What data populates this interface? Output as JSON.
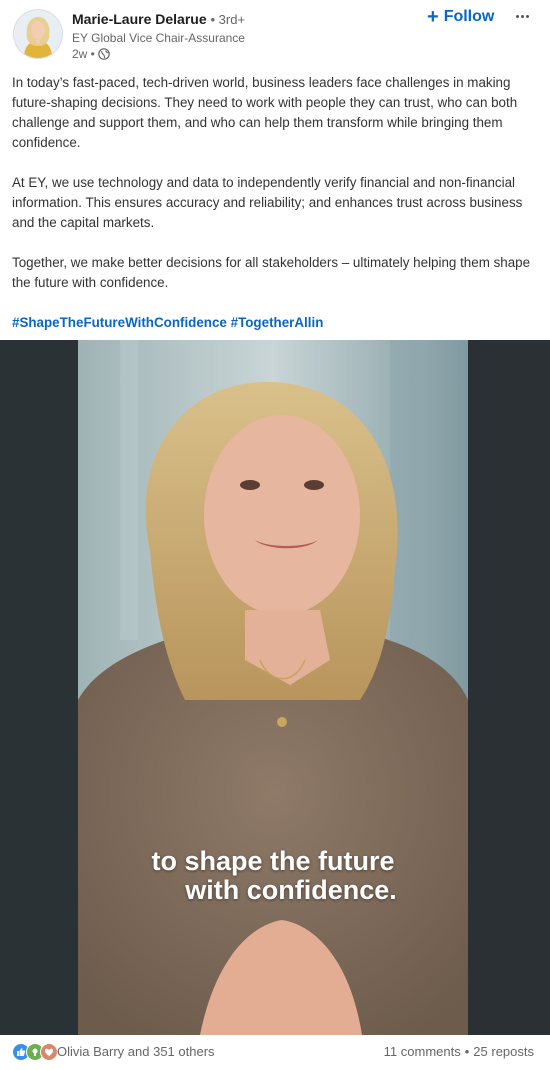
{
  "author": {
    "name": "Marie-Laure Delarue",
    "degree": "• 3rd+",
    "headline": "EY Global Vice Chair-Assurance",
    "time": "2w •",
    "visibility_icon": "globe-icon"
  },
  "actions": {
    "follow_plus": "+",
    "follow_label": "Follow",
    "more_icon": "ellipsis-icon"
  },
  "post": {
    "paragraphs": [
      "In today’s fast-paced, tech-driven world, business leaders face challenges in making future-shaping decisions. They need to work with people they can trust, who can both challenge and support them, and who can help them transform while bringing them confidence.",
      "At EY, we use technology and data to independently verify financial and non-financial information. This ensures accuracy and reliability; and enhances trust across business and the capital markets.",
      "Together, we make better decisions for all stakeholders – ultimately helping them shape the future with confidence."
    ],
    "hashtags": [
      "#ShapeTheFutureWithConfidence",
      "#TogetherAllin"
    ]
  },
  "video": {
    "caption_line1": "to shape the future",
    "caption_line2": "with confidence."
  },
  "social": {
    "reaction_icons": [
      "like-icon",
      "celebrate-icon",
      "support-icon"
    ],
    "reactors": "Olivia Barry and 351 others",
    "comments": "11 comments",
    "separator": "•",
    "reposts": "25 reposts"
  },
  "colors": {
    "brand_blue": "#0a66c2",
    "text_secondary": "#666666"
  }
}
